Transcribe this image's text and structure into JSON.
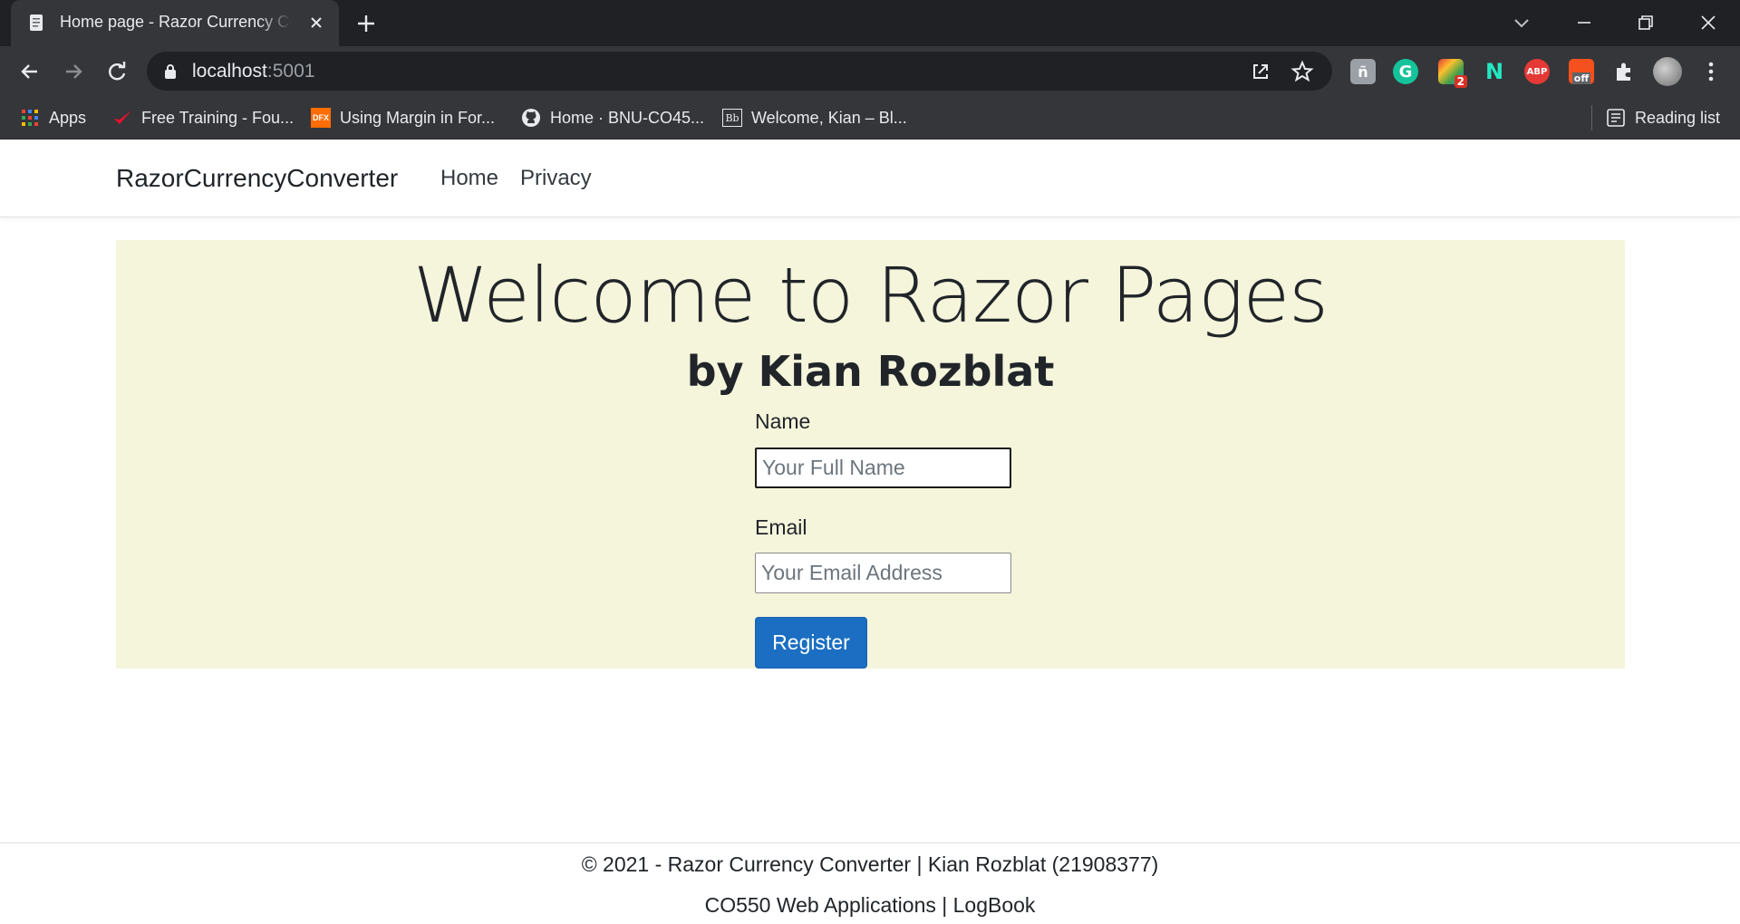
{
  "browser": {
    "tab": {
      "title": "Home page - Razor Currency Converter"
    },
    "address_bar": {
      "host": "localhost",
      "port": ":5001"
    },
    "extensions": {
      "grammarly": "G",
      "badge_count": "2",
      "adblock": "ABP",
      "coupon": "off"
    },
    "bookmarks": [
      {
        "label": "Apps"
      },
      {
        "label": "Free Training - Fou..."
      },
      {
        "label": "Using Margin in For..."
      },
      {
        "label": "Home · BNU-CO45..."
      },
      {
        "label": "Welcome, Kian – Bl..."
      }
    ],
    "dfx_icon_text": "DFX",
    "bb_icon_text": "Bb",
    "reading_list": "Reading list"
  },
  "site": {
    "brand": "RazorCurrencyConverter",
    "nav": [
      {
        "label": "Home"
      },
      {
        "label": "Privacy"
      }
    ]
  },
  "hero": {
    "title": "Welcome to Razor Pages",
    "subtitle": "by Kian Rozblat",
    "background_color": "#f5f5dc"
  },
  "form": {
    "name_label": "Name",
    "name_placeholder": "Your Full Name",
    "name_value": "",
    "email_label": "Email",
    "email_placeholder": "Your Email Address",
    "email_value": "",
    "submit_label": "Register",
    "submit_color": "#1b6ec2"
  },
  "footer": {
    "line1": "© 2021 - Razor Currency Converter | Kian Rozblat (21908377)",
    "line2": "CO550 Web Applications | LogBook"
  }
}
